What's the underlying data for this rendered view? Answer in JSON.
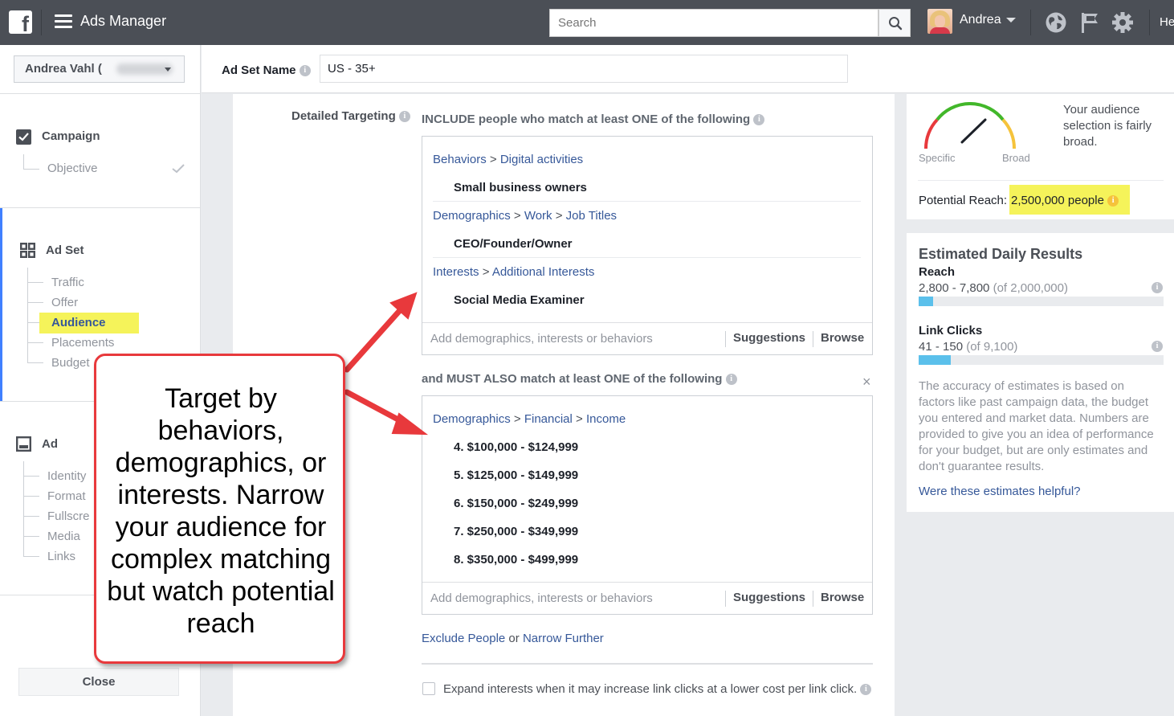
{
  "topbar": {
    "app_title": "Ads Manager",
    "search_placeholder": "Search",
    "user_name": "Andrea",
    "help_label": "He",
    "icons": [
      "facebook-logo",
      "menu-icon",
      "search-icon",
      "globe-icon",
      "flag-icon",
      "gear-icon"
    ]
  },
  "leftnav": {
    "account_name": "Andrea Vahl (",
    "campaign": {
      "title": "Campaign",
      "items": [
        "Objective"
      ]
    },
    "adset": {
      "title": "Ad Set",
      "items": [
        "Traffic",
        "Offer",
        "Audience",
        "Placements",
        "Budget"
      ]
    },
    "ad": {
      "title": "Ad",
      "items": [
        "Identity",
        "Format",
        "Fullscre",
        "Media",
        "Links"
      ]
    },
    "close_label": "Close",
    "highlight_color": "#f5f35a"
  },
  "adset_name": {
    "label": "Ad Set Name",
    "value": "US - 35+"
  },
  "targeting": {
    "label": "Detailed Targeting",
    "include_heading": "INCLUDE people who match at least ONE of the following",
    "include_groups": [
      {
        "crumbs": [
          "Behaviors",
          "Digital activities"
        ],
        "items": [
          "Small business owners"
        ]
      },
      {
        "crumbs": [
          "Demographics",
          "Work",
          "Job Titles"
        ],
        "items": [
          "CEO/Founder/Owner"
        ]
      },
      {
        "crumbs": [
          "Interests",
          "Additional Interests"
        ],
        "items": [
          "Social Media Examiner"
        ]
      }
    ],
    "narrow_heading": "and MUST ALSO match at least ONE of the following",
    "narrow_close": "×",
    "narrow_groups": [
      {
        "crumbs": [
          "Demographics",
          "Financial",
          "Income"
        ],
        "items": [
          "4. $100,000 - $124,999",
          "5. $125,000 - $149,999",
          "6. $150,000 - $249,999",
          "7. $250,000 - $349,999",
          "8. $350,000 - $499,999"
        ]
      }
    ],
    "crumb_separator": ">",
    "input_placeholder": "Add demographics, interests or behaviors",
    "suggestions_label": "Suggestions",
    "browse_label": "Browse",
    "exclude_link": "Exclude People",
    "or_text": "or",
    "narrow_link": "Narrow Further",
    "expand_label": "Expand interests when it may increase link clicks at a lower cost per link click."
  },
  "audience": {
    "gauge_specific": "Specific",
    "gauge_broad": "Broad",
    "description": "Your audience selection is fairly broad.",
    "potential_reach_label": "Potential Reach:",
    "potential_reach_value": "2,500,000 people"
  },
  "estimates": {
    "title": "Estimated Daily Results",
    "metrics": [
      {
        "label": "Reach",
        "range": "2,800 - 7,800",
        "of": "(of 2,000,000)",
        "fill": 0.06
      },
      {
        "label": "Link Clicks",
        "range": "41 - 150",
        "of": "(of 9,100)",
        "fill": 0.13
      }
    ],
    "accuracy_note": "The accuracy of estimates is based on factors like past campaign data, the budget you entered and market data. Numbers are provided to give you an idea of performance for your budget, but are only estimates and don't guarantee results.",
    "helpful_link": "Were these estimates helpful?",
    "bar_color": "#5bc0eb"
  },
  "annotation": {
    "text": "Target by behaviors, demographics, or interests.  Narrow your audience for complex matching but watch potential reach",
    "border_color": "#e8393c"
  },
  "colors": {
    "topbar": "#4b4f56",
    "link": "#365899",
    "accent": "#4080ff"
  }
}
